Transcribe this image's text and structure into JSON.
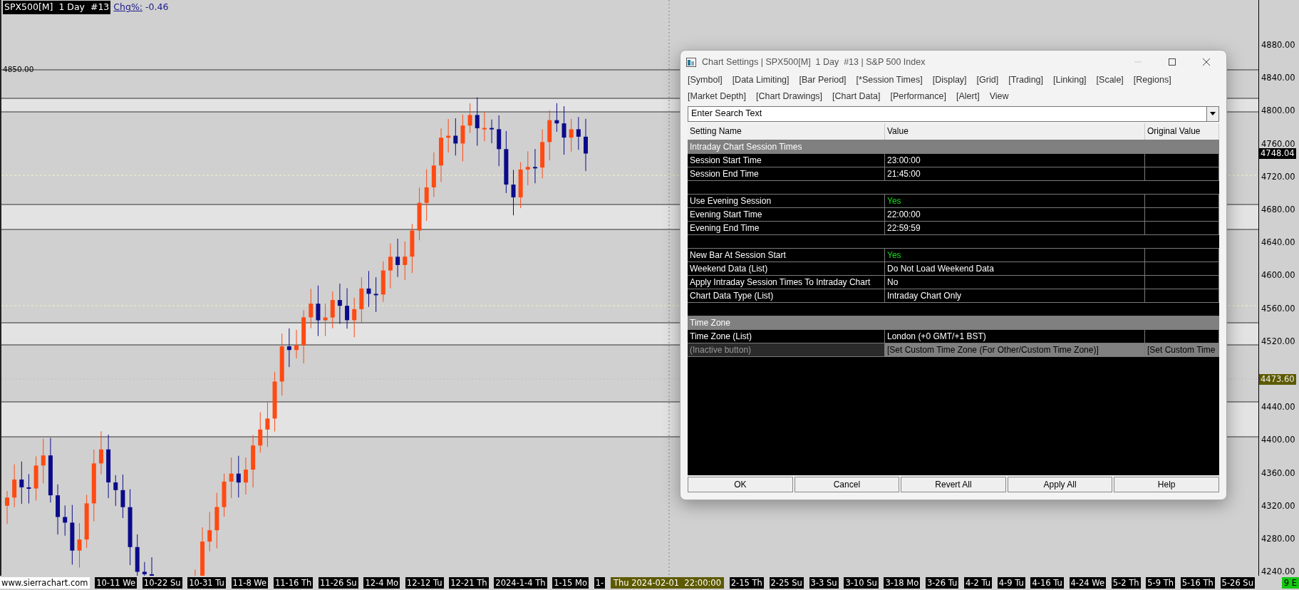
{
  "chart_header": {
    "symbol": "SPX500[M]  1 Day  #13",
    "change_label": "Chg%:",
    "change_value": "-0.46"
  },
  "level_label": "4850.00",
  "price_axis": {
    "ticks": [
      "4880.00",
      "4840.00",
      "4800.00",
      "4760.00",
      "4720.00",
      "4680.00",
      "4640.00",
      "4600.00",
      "4560.00",
      "4520.00",
      "4440.00",
      "4400.00",
      "4360.00",
      "4320.00",
      "4280.00",
      "4240.00"
    ],
    "last_price": "4748.04",
    "cursor_price": "4473.60"
  },
  "time_axis": {
    "site": "www.sierrachart.com",
    "labels": [
      {
        "kind": "date",
        "text": "10-11 We"
      },
      {
        "kind": "date",
        "text": "10-22 Su"
      },
      {
        "kind": "date",
        "text": "10-31 Tu"
      },
      {
        "kind": "date",
        "text": "11-8 We"
      },
      {
        "kind": "date",
        "text": "11-16 Th"
      },
      {
        "kind": "date",
        "text": "11-26 Su"
      },
      {
        "kind": "date",
        "text": "12-4 Mo"
      },
      {
        "kind": "date",
        "text": "12-12 Tu"
      },
      {
        "kind": "date",
        "text": "12-21 Th"
      },
      {
        "kind": "date",
        "text": "2024-1-4 Th"
      },
      {
        "kind": "date",
        "text": "1-15 Mo"
      },
      {
        "kind": "date",
        "text": "1-"
      },
      {
        "kind": "cursor",
        "text": "Thu 2024-02-01  22:00:00"
      },
      {
        "kind": "date",
        "text": "2-15 Th"
      },
      {
        "kind": "date",
        "text": "2-25 Su"
      },
      {
        "kind": "date",
        "text": "3-3 Su"
      },
      {
        "kind": "date",
        "text": "3-10 Su"
      },
      {
        "kind": "date",
        "text": "3-18 Mo"
      },
      {
        "kind": "date",
        "text": "3-26 Tu"
      },
      {
        "kind": "date",
        "text": "4-2 Tu"
      },
      {
        "kind": "date",
        "text": "4-9 Tu"
      },
      {
        "kind": "date",
        "text": "4-16 Tu"
      },
      {
        "kind": "date",
        "text": "4-24 We"
      },
      {
        "kind": "date",
        "text": "5-2 Th"
      },
      {
        "kind": "date",
        "text": "5-9 Th"
      },
      {
        "kind": "date",
        "text": "5-16 Th"
      },
      {
        "kind": "date",
        "text": "5-26 Su"
      }
    ],
    "corner": "9 E"
  },
  "dialog": {
    "title": "Chart Settings | SPX500[M]  1 Day  #13 | S&P 500 Index",
    "tab_rows": [
      [
        "[Symbol]",
        "[Data Limiting]",
        "[Bar Period]",
        "[*Session Times]",
        "[Display]",
        "[Grid]",
        "[Trading]",
        "[Linking]",
        "[Scale]",
        "[Regions]"
      ],
      [
        "[Market Depth]",
        "[Chart Drawings]",
        "[Chart Data]",
        "[Performance]",
        "[Alert]",
        "View"
      ]
    ],
    "search": {
      "value": "Enter Search Text"
    },
    "columns": [
      "Setting Name",
      "Value",
      "Original Value"
    ],
    "rows": [
      {
        "kind": "section",
        "name": "Intraday Chart Session Times"
      },
      {
        "kind": "setting",
        "name": "Session Start Time",
        "value": "23:00:00",
        "emphasis": false
      },
      {
        "kind": "setting",
        "name": "Session End Time",
        "value": "21:45:00",
        "emphasis": false
      },
      {
        "kind": "blank"
      },
      {
        "kind": "setting",
        "name": "Use Evening Session",
        "value": "Yes",
        "emphasis": true
      },
      {
        "kind": "setting",
        "name": "Evening Start Time",
        "value": "22:00:00",
        "emphasis": false
      },
      {
        "kind": "setting",
        "name": "Evening End Time",
        "value": "22:59:59",
        "emphasis": false
      },
      {
        "kind": "blank"
      },
      {
        "kind": "setting",
        "name": "New Bar At Session Start",
        "value": "Yes",
        "emphasis": true
      },
      {
        "kind": "setting",
        "name": "Weekend Data (List)",
        "value": "Do Not Load Weekend Data",
        "emphasis": false
      },
      {
        "kind": "setting",
        "name": "Apply Intraday Session Times To Intraday Chart",
        "value": "No",
        "emphasis": false
      },
      {
        "kind": "setting",
        "name": "Chart Data Type (List)",
        "value": "Intraday Chart Only",
        "emphasis": false
      },
      {
        "kind": "blank"
      },
      {
        "kind": "section",
        "name": "Time Zone"
      },
      {
        "kind": "setting",
        "name": "Time Zone (List)",
        "value": "London (+0 GMT/+1 BST)",
        "emphasis": false
      },
      {
        "kind": "inactive",
        "name": "(Inactive button)",
        "value": "[Set Custom Time Zone (For Other/Custom Time Zone)]",
        "original": "[Set Custom Time"
      }
    ],
    "buttons": [
      "OK",
      "Cancel",
      "Revert All",
      "Apply All",
      "Help"
    ]
  }
}
